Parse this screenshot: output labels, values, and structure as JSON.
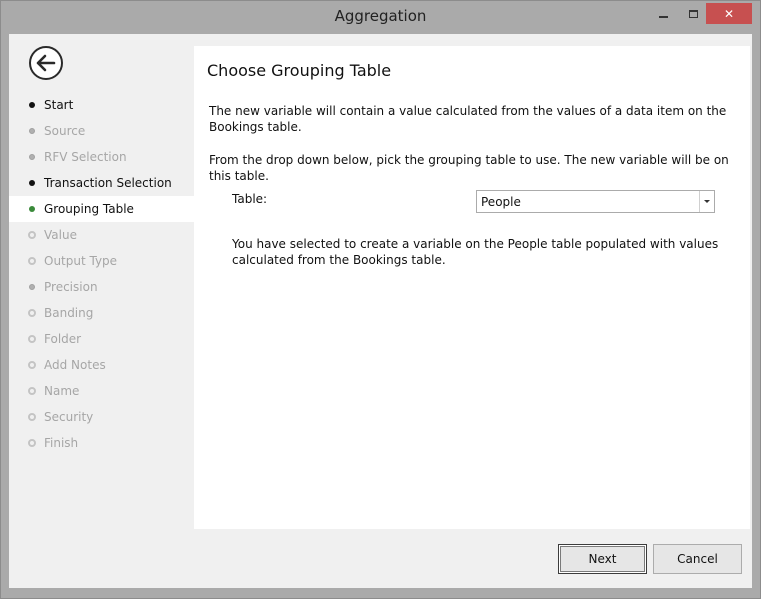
{
  "window": {
    "title": "Aggregation",
    "controls": {
      "minimize_icon": "minimize-icon",
      "maximize_icon": "maximize-icon",
      "close_glyph": "✕",
      "close_color": "#c75050"
    }
  },
  "back_icon": "back-arrow-icon",
  "steps": [
    {
      "label": "Start",
      "state": "done"
    },
    {
      "label": "Source",
      "state": "skipped"
    },
    {
      "label": "RFV Selection",
      "state": "skipped"
    },
    {
      "label": "Transaction Selection",
      "state": "done"
    },
    {
      "label": "Grouping Table",
      "state": "current"
    },
    {
      "label": "Value",
      "state": "pending"
    },
    {
      "label": "Output Type",
      "state": "pending"
    },
    {
      "label": "Precision",
      "state": "skipped"
    },
    {
      "label": "Banding",
      "state": "pending"
    },
    {
      "label": "Folder",
      "state": "pending"
    },
    {
      "label": "Add Notes",
      "state": "pending"
    },
    {
      "label": "Name",
      "state": "pending"
    },
    {
      "label": "Security",
      "state": "pending"
    },
    {
      "label": "Finish",
      "state": "pending"
    }
  ],
  "panel": {
    "title": "Choose Grouping Table",
    "intro": "The new variable will contain a value calculated from the values of a data item on the Bookings table.",
    "instruction": "From the drop down below, pick the grouping table to use. The new variable will be on this table.",
    "table_label": "Table:",
    "table_value": "People",
    "summary": "You have selected to create a variable on the People table populated with values calculated from the Bookings table."
  },
  "buttons": {
    "next": "Next",
    "cancel": "Cancel"
  },
  "colors": {
    "current_step_dot": "#3a8a3a",
    "disabled_text": "#a6a6a6"
  }
}
